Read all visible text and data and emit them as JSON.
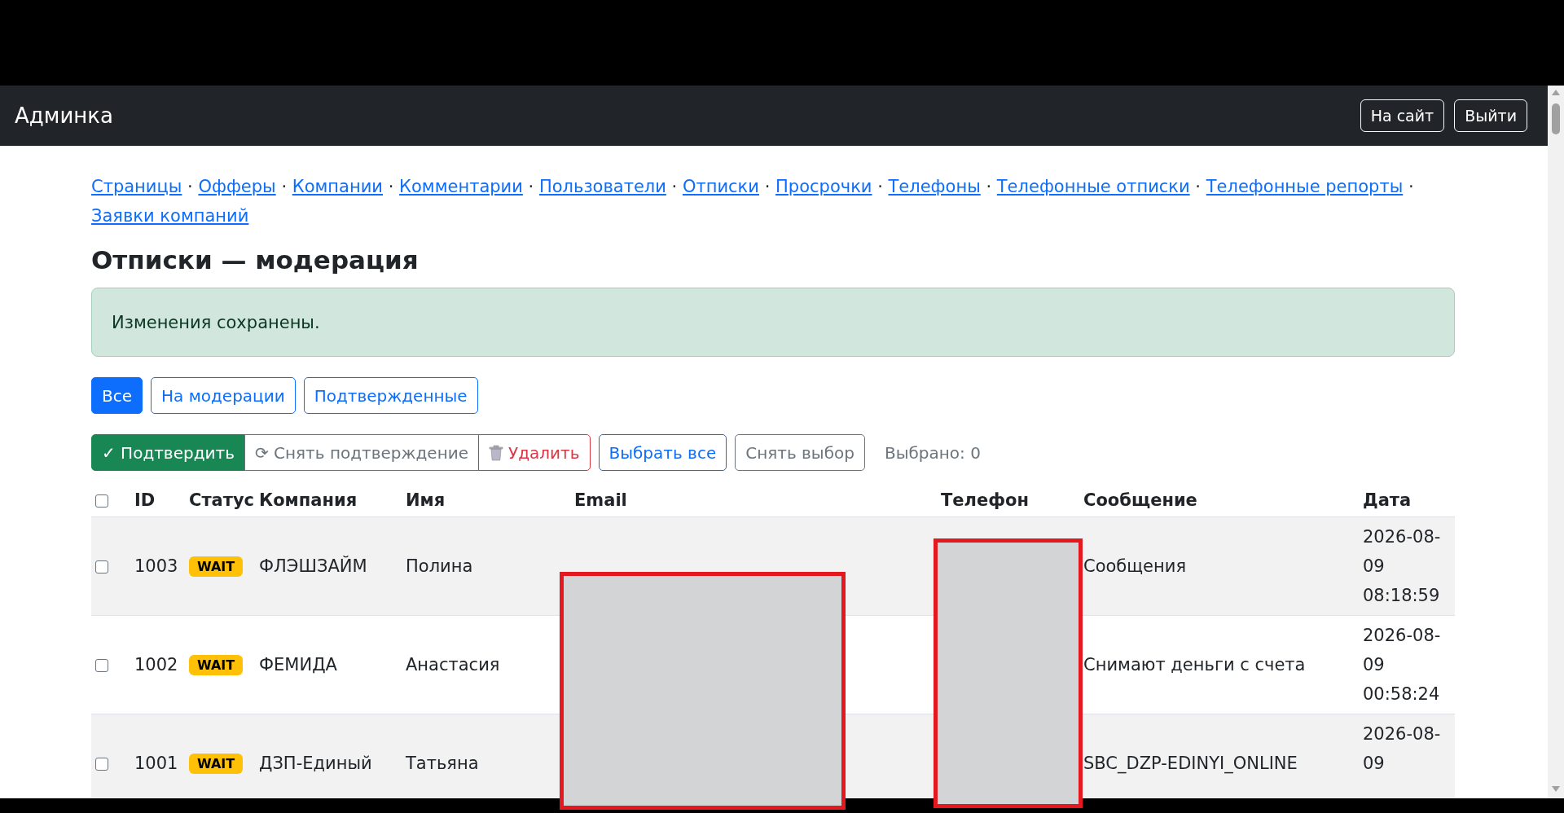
{
  "navbar": {
    "title": "Админка",
    "buttons": [
      "На сайт",
      "Выйти"
    ]
  },
  "nav_links": [
    {
      "label": "Страницы",
      "separator": "·"
    },
    {
      "label": "Офферы",
      "separator": "·"
    },
    {
      "label": "Компании",
      "separator": "·"
    },
    {
      "label": "Комментарии",
      "separator": "·"
    },
    {
      "label": "Пользователи",
      "separator": "·"
    },
    {
      "label": "Отписки",
      "separator": "·"
    },
    {
      "label": "Просрочки",
      "separator": "·"
    },
    {
      "label": "Телефоны",
      "separator": "·"
    },
    {
      "label": "Телефонные отписки",
      "separator": "·"
    },
    {
      "label": "Телефонные репорты",
      "separator": "·"
    },
    {
      "label": "Заявки компаний"
    }
  ],
  "heading": "Отписки — модерация",
  "alert": "Изменения сохранены.",
  "filters": [
    {
      "label": "Все",
      "selected": true
    },
    {
      "label": "На модерации",
      "selected": false
    },
    {
      "label": "Подтвержденные",
      "selected": false
    }
  ],
  "actions": [
    {
      "kind": "success",
      "label": "✓ Подтвердить"
    },
    {
      "kind": "secondary",
      "label": "⟳ Снять подтверждение"
    },
    {
      "kind": "danger",
      "label": "Удалить"
    }
  ],
  "select_buttons": [
    {
      "kind": "primary",
      "label": "Выбрать все"
    },
    {
      "kind": "secondary",
      "label": "Снять выбор"
    }
  ],
  "selected_count": "Выбрано: 0",
  "table": {
    "select_all": {
      "checked": false
    },
    "columns": [
      "ID",
      "Статус",
      "Компания",
      "Имя",
      "Email",
      "Телефон",
      "Сообщение",
      "Дата"
    ],
    "rows": [
      {
        "checked": false,
        "id": "1003",
        "status": "WAIT",
        "company": "ФЛЭШЗАЙМ",
        "name": "Полина",
        "message": "Сообщения",
        "date": "2026-08-09 08:18:59"
      },
      {
        "checked": false,
        "id": "1002",
        "status": "WAIT",
        "company": "ФЕМИДА",
        "name": "Анастасия",
        "message": "Снимают деньги с счета",
        "date": "2026-08-09 00:58:24"
      },
      {
        "checked": false,
        "id": "1001",
        "status": "WAIT",
        "company": "ДЗП-Единый",
        "name": "Татьяна",
        "message": "SBC_DZP-EDINYI_ONLINE",
        "date": "2026-08-09"
      }
    ]
  }
}
